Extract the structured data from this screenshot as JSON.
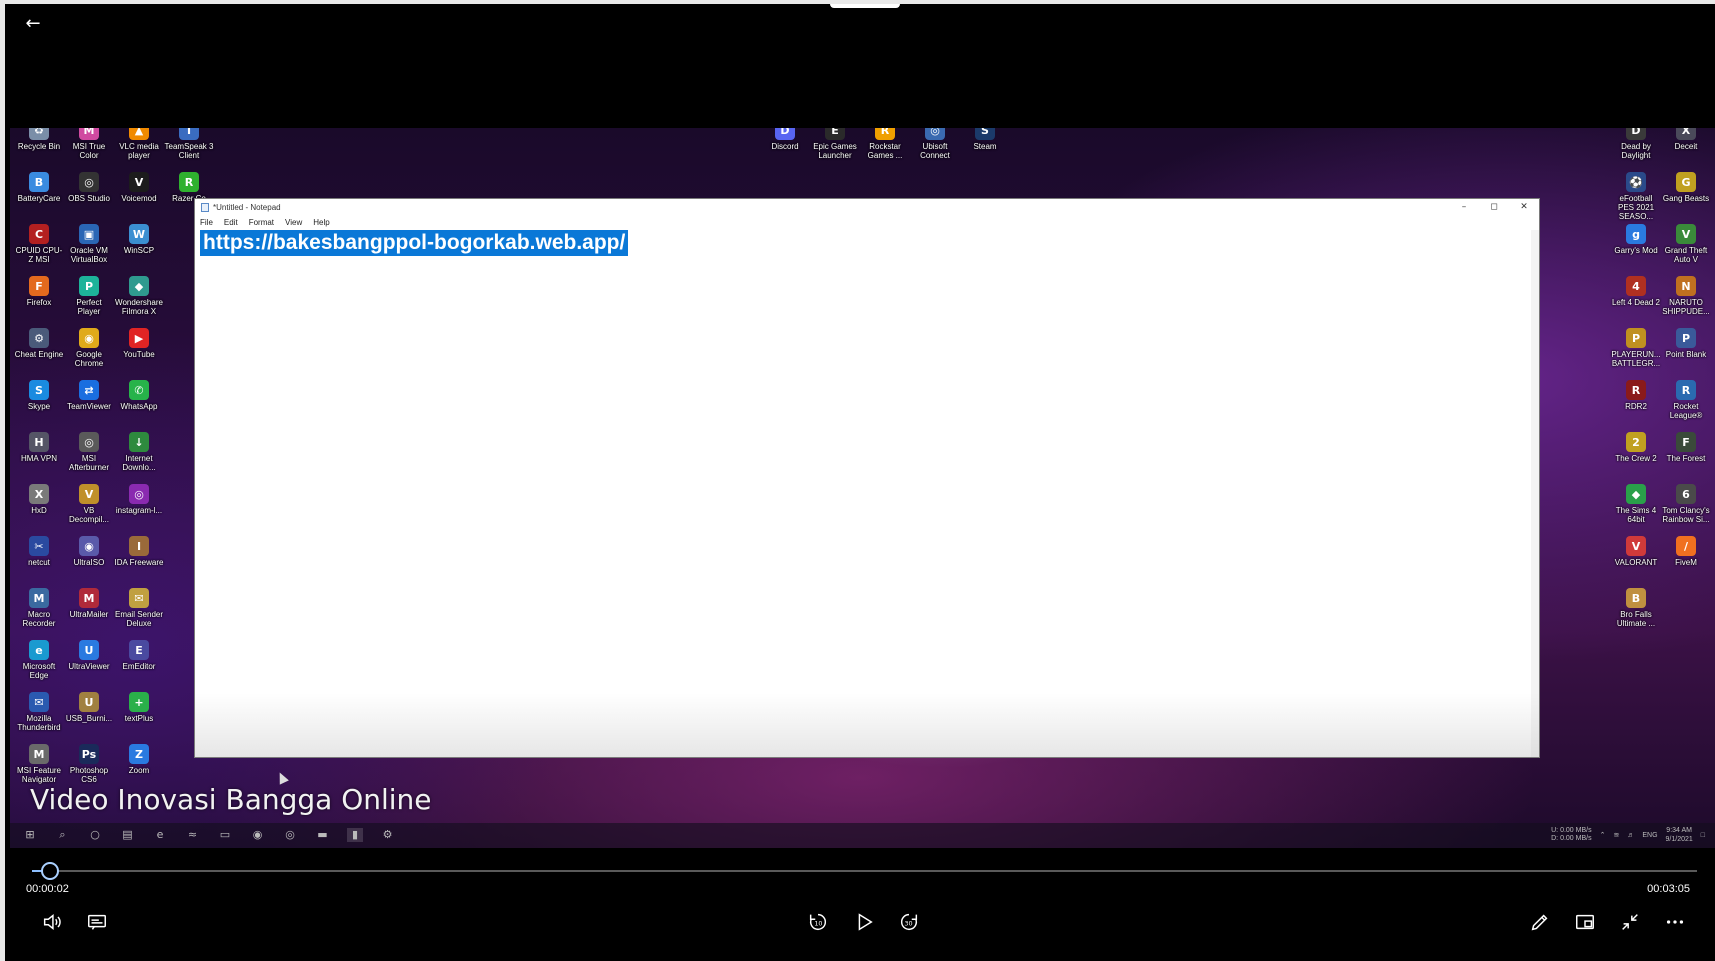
{
  "window": {
    "back_icon": "arrow-left-icon"
  },
  "desktop": {
    "left_icons": [
      {
        "label": "Recycle Bin",
        "icon": "recycle-bin-icon",
        "color": "#7a8ea8",
        "glyph": "♻"
      },
      {
        "label": "MSI True Color",
        "icon": "msi-true-color-icon",
        "color": "#d04aa0",
        "glyph": "M"
      },
      {
        "label": "VLC media player",
        "icon": "vlc-icon",
        "color": "#f08a00",
        "glyph": "▲"
      },
      {
        "label": "TeamSpeak 3 Client",
        "icon": "teamspeak-icon",
        "color": "#3a6cc0",
        "glyph": "T"
      },
      {
        "label": "BatteryCare",
        "icon": "batterycare-icon",
        "color": "#3a8be0",
        "glyph": "B"
      },
      {
        "label": "OBS Studio",
        "icon": "obs-icon",
        "color": "#333333",
        "glyph": "◎"
      },
      {
        "label": "Voicemod",
        "icon": "voicemod-icon",
        "color": "#1c1c1c",
        "glyph": "V"
      },
      {
        "label": "Razer Co",
        "icon": "razer-icon",
        "color": "#2fb12f",
        "glyph": "R"
      },
      {
        "label": "CPUID CPU-Z MSI",
        "icon": "cpuz-icon",
        "color": "#b32020",
        "glyph": "C"
      },
      {
        "label": "Oracle VM VirtualBox",
        "icon": "virtualbox-icon",
        "color": "#2a66b5",
        "glyph": "▣"
      },
      {
        "label": "WinSCP",
        "icon": "winscp-icon",
        "color": "#3b8fd1",
        "glyph": "W"
      },
      {
        "label": "Firefox",
        "icon": "firefox-icon",
        "color": "#e36a1e",
        "glyph": "F"
      },
      {
        "label": "Perfect Player",
        "icon": "perfect-player-icon",
        "color": "#1db39a",
        "glyph": "P"
      },
      {
        "label": "Wondershare Filmora X",
        "icon": "filmora-icon",
        "color": "#2f9a8f",
        "glyph": "◆"
      },
      {
        "label": "Cheat Engine",
        "icon": "cheat-engine-icon",
        "color": "#4a5a7a",
        "glyph": "⚙"
      },
      {
        "label": "Google Chrome",
        "icon": "chrome-icon",
        "color": "#e0aa1a",
        "glyph": "◉"
      },
      {
        "label": "YouTube",
        "icon": "youtube-icon",
        "color": "#e02424",
        "glyph": "▶"
      },
      {
        "label": "Skype",
        "icon": "skype-icon",
        "color": "#1a8be0",
        "glyph": "S"
      },
      {
        "label": "TeamViewer",
        "icon": "teamviewer-icon",
        "color": "#1a6ee0",
        "glyph": "⇄"
      },
      {
        "label": "WhatsApp",
        "icon": "whatsapp-icon",
        "color": "#27b34a",
        "glyph": "✆"
      },
      {
        "label": "HMA VPN",
        "icon": "hma-vpn-icon",
        "color": "#555566",
        "glyph": "H"
      },
      {
        "label": "MSI Afterburner",
        "icon": "afterburner-icon",
        "color": "#5a5a5a",
        "glyph": "◎"
      },
      {
        "label": "Internet Downlo...",
        "icon": "idm-icon",
        "color": "#2e8a3e",
        "glyph": "↓"
      },
      {
        "label": "HxD",
        "icon": "hxd-icon",
        "color": "#7a7a7a",
        "glyph": "X"
      },
      {
        "label": "VB Decompil...",
        "icon": "vb-decompiler-icon",
        "color": "#c0902a",
        "glyph": "V"
      },
      {
        "label": "instagram-l...",
        "icon": "instagram-icon",
        "color": "#8a2ab0",
        "glyph": "◎"
      },
      {
        "label": "netcut",
        "icon": "netcut-icon",
        "color": "#2a4aa0",
        "glyph": "✂"
      },
      {
        "label": "UltraISO",
        "icon": "ultraiso-icon",
        "color": "#5a5aaa",
        "glyph": "◉"
      },
      {
        "label": "IDA Freeware",
        "icon": "ida-icon",
        "color": "#9a6a3a",
        "glyph": "I"
      },
      {
        "label": "Macro Recorder",
        "icon": "macro-recorder-icon",
        "color": "#3a6aa0",
        "glyph": "M"
      },
      {
        "label": "UltraMailer",
        "icon": "ultramailer-icon",
        "color": "#b02a3a",
        "glyph": "M"
      },
      {
        "label": "Email Sender Deluxe",
        "icon": "email-sender-icon",
        "color": "#c0a040",
        "glyph": "✉"
      },
      {
        "label": "Microsoft Edge",
        "icon": "edge-icon",
        "color": "#1a9ad0",
        "glyph": "e"
      },
      {
        "label": "UltraViewer",
        "icon": "ultraviewer-icon",
        "color": "#2a7ae0",
        "glyph": "U"
      },
      {
        "label": "EmEditor",
        "icon": "emeditor-icon",
        "color": "#4a4aa0",
        "glyph": "E"
      },
      {
        "label": "Mozilla Thunderbird",
        "icon": "thunderbird-icon",
        "color": "#2a5ab0",
        "glyph": "✉"
      },
      {
        "label": "USB_Burni...",
        "icon": "usb-burning-icon",
        "color": "#a08040",
        "glyph": "U"
      },
      {
        "label": "textPlus",
        "icon": "textplus-icon",
        "color": "#2ab04a",
        "glyph": "+"
      },
      {
        "label": "MSI Feature Navigator",
        "icon": "msi-feature-icon",
        "color": "#6a6a6a",
        "glyph": "M"
      },
      {
        "label": "Photoshop CS6",
        "icon": "photoshop-icon",
        "color": "#1a2a5a",
        "glyph": "Ps"
      },
      {
        "label": "Zoom",
        "icon": "zoom-icon",
        "color": "#2a7ae0",
        "glyph": "Z"
      }
    ],
    "top_icons": [
      {
        "label": "Discord",
        "icon": "discord-icon",
        "color": "#5865f2",
        "glyph": "D"
      },
      {
        "label": "Epic Games Launcher",
        "icon": "epic-games-icon",
        "color": "#2a2a2a",
        "glyph": "E"
      },
      {
        "label": "Rockstar Games ...",
        "icon": "rockstar-icon",
        "color": "#f0a000",
        "glyph": "R"
      },
      {
        "label": "Ubisoft Connect",
        "icon": "ubisoft-icon",
        "color": "#3a6ab0",
        "glyph": "◎"
      },
      {
        "label": "Steam",
        "icon": "steam-icon",
        "color": "#1b3a6a",
        "glyph": "S"
      }
    ],
    "right_icons": [
      {
        "label": "Dead by Daylight",
        "icon": "dead-by-daylight-icon",
        "color": "#3a3a3a",
        "glyph": "D"
      },
      {
        "label": "Deceit",
        "icon": "deceit-icon",
        "color": "#4a4a5a",
        "glyph": "X"
      },
      {
        "label": "eFootball PES 2021 SEASO...",
        "icon": "efootball-icon",
        "color": "#2a4a8a",
        "glyph": "⚽"
      },
      {
        "label": "Gang Beasts",
        "icon": "gang-beasts-icon",
        "color": "#c0a020",
        "glyph": "G"
      },
      {
        "label": "Garry's Mod",
        "icon": "garrys-mod-icon",
        "color": "#2a7ae0",
        "glyph": "g"
      },
      {
        "label": "Grand Theft Auto V",
        "icon": "gta-icon",
        "color": "#3a8a3a",
        "glyph": "V"
      },
      {
        "label": "Left 4 Dead 2",
        "icon": "l4d2-icon",
        "color": "#b03020",
        "glyph": "4"
      },
      {
        "label": "NARUTO SHIPPUDE...",
        "icon": "naruto-icon",
        "color": "#c07020",
        "glyph": "N"
      },
      {
        "label": "PLAYERUN... BATTLEGR...",
        "icon": "pubg-icon",
        "color": "#c09020",
        "glyph": "P"
      },
      {
        "label": "Point Blank",
        "icon": "point-blank-icon",
        "color": "#3a5a9a",
        "glyph": "P"
      },
      {
        "label": "RDR2",
        "icon": "rdr2-icon",
        "color": "#8a1a1a",
        "glyph": "R"
      },
      {
        "label": "Rocket League®",
        "icon": "rocket-league-icon",
        "color": "#2a6ab0",
        "glyph": "R"
      },
      {
        "label": "The Crew 2",
        "icon": "the-crew-icon",
        "color": "#c0a020",
        "glyph": "2"
      },
      {
        "label": "The Forest",
        "icon": "the-forest-icon",
        "color": "#3a4a3a",
        "glyph": "F"
      },
      {
        "label": "The Sims 4 64bit",
        "icon": "sims-icon",
        "color": "#2aa04a",
        "glyph": "◆"
      },
      {
        "label": "Tom Clancy's Rainbow Si...",
        "icon": "rainbow-six-icon",
        "color": "#4a4a4a",
        "glyph": "6"
      },
      {
        "label": "VALORANT",
        "icon": "valorant-icon",
        "color": "#d03a3a",
        "glyph": "V"
      },
      {
        "label": "FiveM",
        "icon": "fivem-icon",
        "color": "#f07020",
        "glyph": "/"
      },
      {
        "label": "Bro Falls Ultimate ...",
        "icon": "bro-falls-icon",
        "color": "#c09040",
        "glyph": "B"
      }
    ]
  },
  "notepad": {
    "title": "*Untitled - Notepad",
    "menu": [
      "File",
      "Edit",
      "Format",
      "View",
      "Help"
    ],
    "selected_text": "https://bakesbangppol-bogorkab.web.app/"
  },
  "taskbar": {
    "items": [
      "windows-start-icon",
      "search-icon",
      "cortana-icon",
      "store-icon",
      "edge-icon",
      "razer-icon",
      "file-explorer-icon",
      "firefox-icon",
      "chrome-icon",
      "folder-icon",
      "notepad-icon",
      "settings-icon"
    ],
    "net_upload_label": "U:",
    "net_download_label": "D:",
    "net_upload": "0.00 MB/s",
    "net_download": "0.00 MB/s",
    "language": "ENG",
    "time": "9:34 AM",
    "date": "9/1/2021"
  },
  "video": {
    "caption": "Video Inovasi Bangga Online",
    "current_time": "00:00:02",
    "total_time": "00:03:05",
    "progress_fraction": 0.0108
  },
  "controls": {
    "left": [
      {
        "name": "volume-button",
        "icon": "volume-icon"
      },
      {
        "name": "subtitles-button",
        "icon": "subtitles-icon"
      }
    ],
    "center": [
      {
        "name": "skip-back-10-button",
        "icon": "rewind-10-icon"
      },
      {
        "name": "play-button",
        "icon": "play-icon"
      },
      {
        "name": "skip-forward-30-button",
        "icon": "forward-30-icon"
      }
    ],
    "right": [
      {
        "name": "edit-button",
        "icon": "pencil-icon"
      },
      {
        "name": "mini-view-button",
        "icon": "mini-view-icon"
      },
      {
        "name": "exit-fullscreen-button",
        "icon": "exit-fullscreen-icon"
      },
      {
        "name": "more-options-button",
        "icon": "more-icon"
      }
    ]
  }
}
